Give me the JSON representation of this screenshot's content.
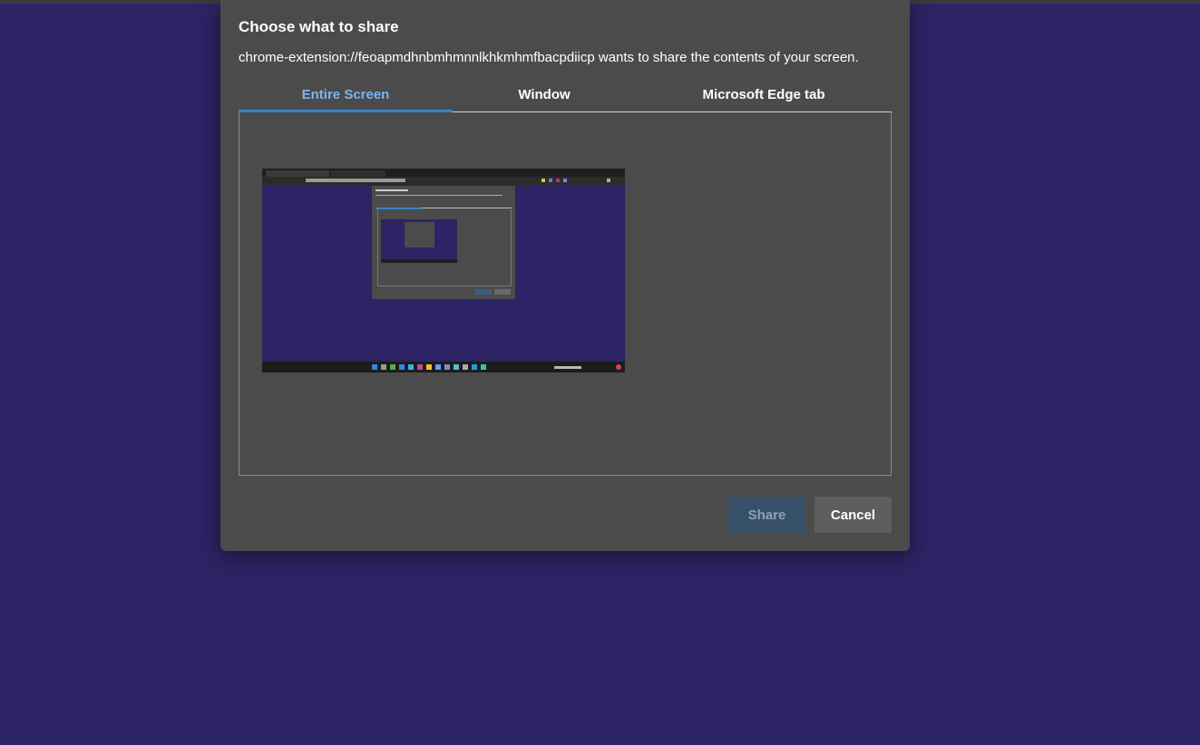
{
  "dialog": {
    "title": "Choose what to share",
    "subtitle": "chrome-extension://feoapmdhnbmhmnnlkhkmhmfbacpdiicp wants to share the contents of your screen."
  },
  "tabs": [
    {
      "label": "Entire Screen",
      "active": true
    },
    {
      "label": "Window",
      "active": false
    },
    {
      "label": "Microsoft Edge tab",
      "active": false
    }
  ],
  "buttons": {
    "share_label": "Share",
    "share_enabled": false,
    "cancel_label": "Cancel"
  },
  "colors": {
    "desktop_background": "#2c2464",
    "dialog_background": "#4b4b4b",
    "active_tab_text": "#7db4f0",
    "active_tab_underline": "#3b82c4",
    "share_button_disabled": "#36506a",
    "cancel_button": "#5e5e5e"
  }
}
